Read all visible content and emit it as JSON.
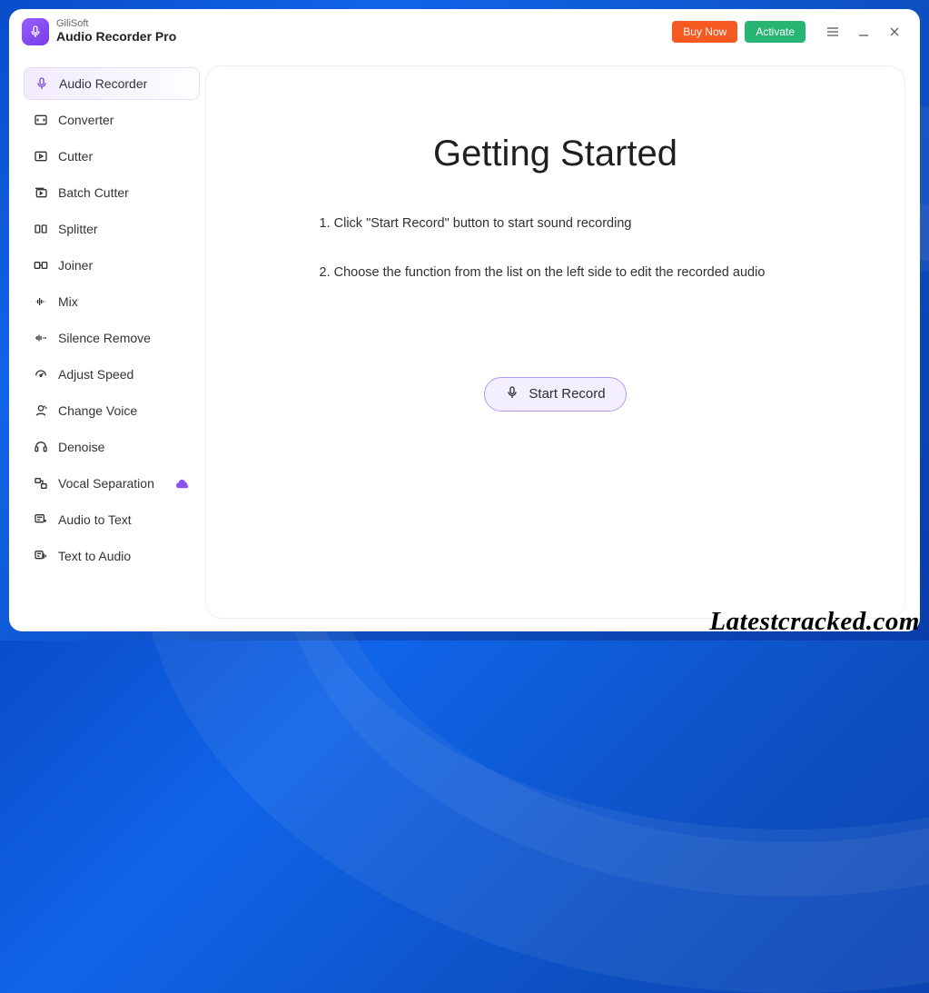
{
  "header": {
    "brand": "GiliSoft",
    "product": "Audio Recorder Pro",
    "buy_label": "Buy Now",
    "activate_label": "Activate"
  },
  "sidebar": {
    "items": [
      {
        "label": "Audio Recorder"
      },
      {
        "label": "Converter"
      },
      {
        "label": "Cutter"
      },
      {
        "label": "Batch Cutter"
      },
      {
        "label": "Splitter"
      },
      {
        "label": "Joiner"
      },
      {
        "label": "Mix"
      },
      {
        "label": "Silence Remove"
      },
      {
        "label": "Adjust Speed"
      },
      {
        "label": "Change Voice"
      },
      {
        "label": "Denoise"
      },
      {
        "label": "Vocal Separation"
      },
      {
        "label": "Audio to Text"
      },
      {
        "label": "Text to Audio"
      }
    ]
  },
  "main": {
    "heading": "Getting Started",
    "step1": "1. Click \"Start Record\" button to start sound recording",
    "step2": "2. Choose the function from the list on the left side to edit the recorded audio",
    "record_label": "Start Record"
  },
  "watermark": "Latestcracked.com"
}
